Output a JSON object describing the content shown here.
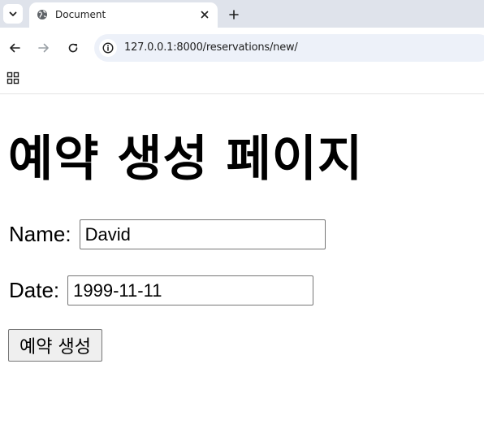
{
  "browser": {
    "tab_title": "Document",
    "url": "127.0.0.1:8000/reservations/new/"
  },
  "page": {
    "heading": "예약 생성 페이지",
    "form": {
      "name_label": "Name:",
      "name_value": "David",
      "date_label": "Date:",
      "date_value": "1999-11-11",
      "submit_label": "예약 생성"
    }
  }
}
